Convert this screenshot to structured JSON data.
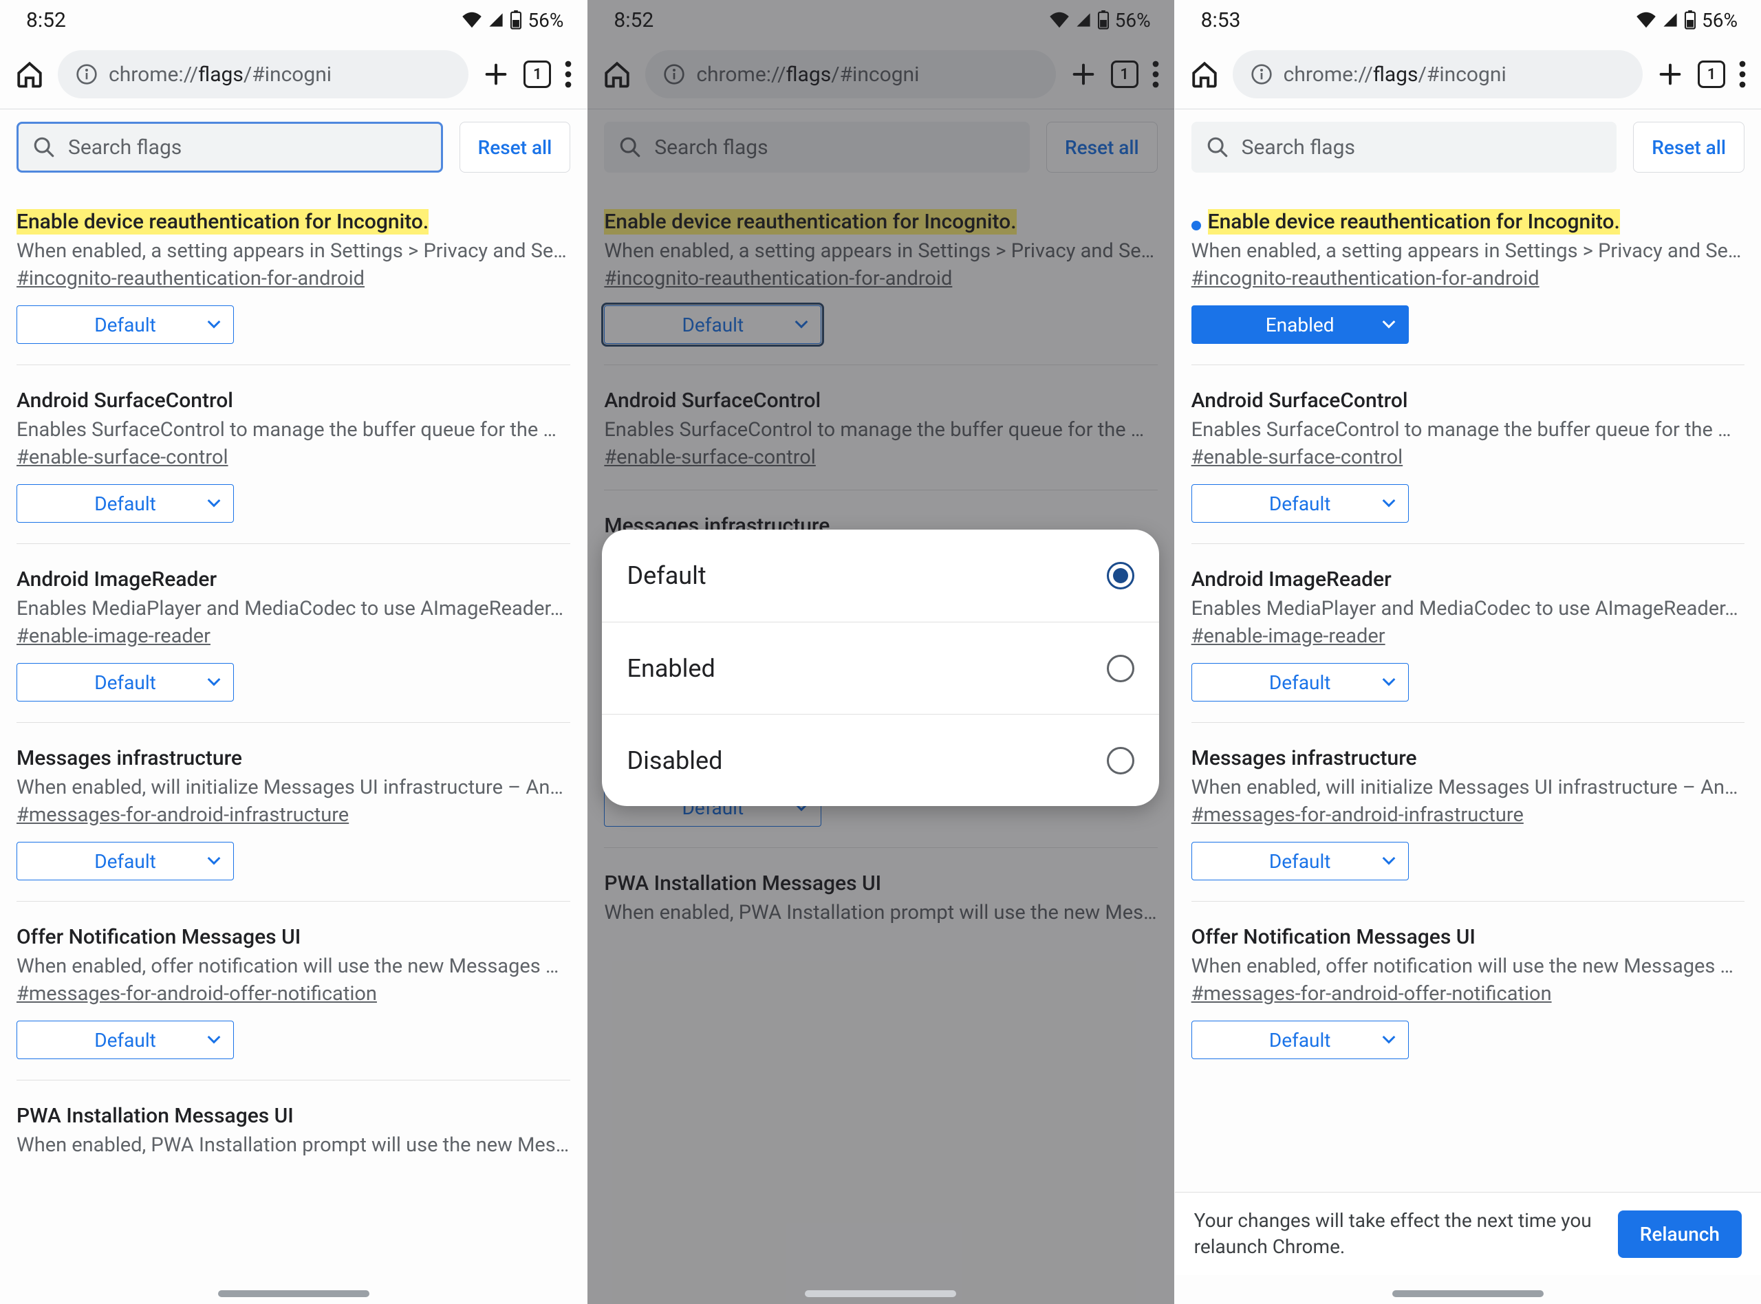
{
  "status": {
    "time_a": "8:52",
    "time_b": "8:52",
    "time_c": "8:53",
    "battery": "56%"
  },
  "chrome": {
    "url_prefix": "chrome://",
    "url_dark": "flags",
    "url_suffix": "/#incogni",
    "tab_count": "1"
  },
  "search": {
    "placeholder": "Search flags",
    "reset": "Reset all"
  },
  "select": {
    "default": "Default",
    "enabled": "Enabled"
  },
  "flags": [
    {
      "title": "Enable device reauthentication for Incognito.",
      "desc": "When enabled, a setting appears in Settings > Privacy and Se…",
      "anchor": "#incognito-reauthentication-for-android"
    },
    {
      "title": "Android SurfaceControl",
      "desc": "Enables SurfaceControl to manage the buffer queue for the …",
      "anchor": "#enable-surface-control"
    },
    {
      "title": "Android ImageReader",
      "desc": "Enables MediaPlayer and MediaCodec to use AImageReader…",
      "anchor": "#enable-image-reader"
    },
    {
      "title": "Messages infrastructure",
      "desc": "When enabled, will initialize Messages UI infrastructure – An…",
      "anchor": "#messages-for-android-infrastructure"
    },
    {
      "title": "Offer Notification Messages UI",
      "desc": "When enabled, offer notification will use the new Messages …",
      "anchor": "#messages-for-android-offer-notification"
    },
    {
      "title": "PWA Installation Messages UI",
      "desc": "When enabled, PWA Installation prompt will use the new Mes…",
      "anchor": ""
    }
  ],
  "popup": {
    "options": [
      "Default",
      "Enabled",
      "Disabled"
    ],
    "selected_index": 0
  },
  "relaunch": {
    "msg": "Your changes will take effect the next time you relaunch Chrome.",
    "btn": "Relaunch"
  }
}
